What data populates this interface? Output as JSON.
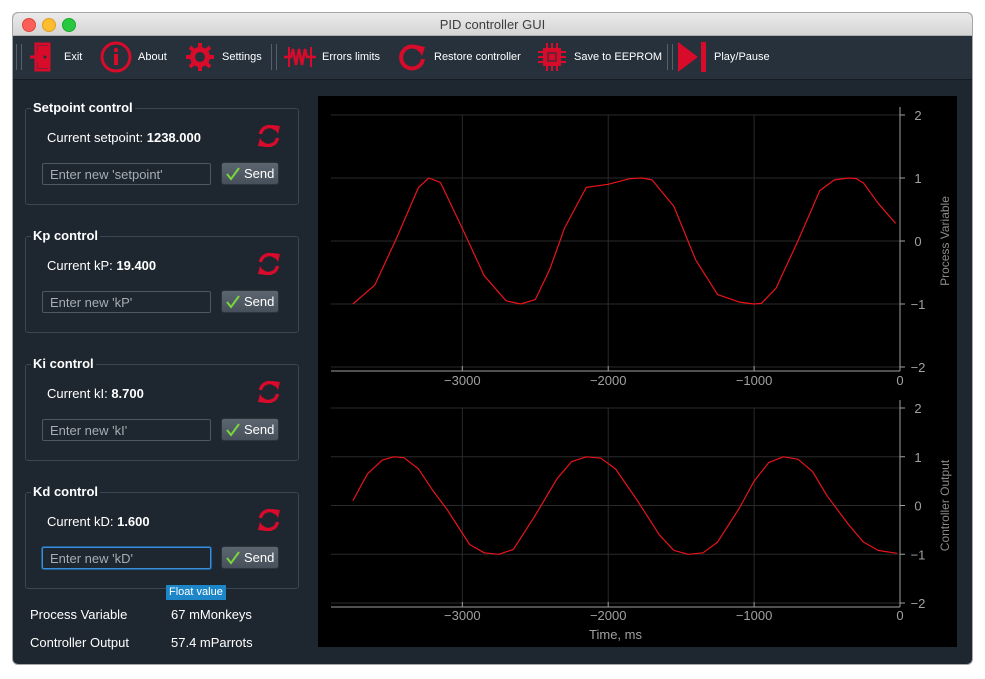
{
  "window": {
    "title": "PID controller GUI"
  },
  "toolbar": {
    "items": [
      {
        "label": "Exit",
        "icon": "exit-door-icon"
      },
      {
        "label": "About",
        "icon": "info-circle-icon"
      },
      {
        "label": "Settings",
        "icon": "gear-icon"
      },
      {
        "label": "Errors limits",
        "icon": "resistor-icon"
      },
      {
        "label": "Restore controller",
        "icon": "restore-arrow-icon"
      },
      {
        "label": "Save to EEPROM",
        "icon": "chip-icon"
      },
      {
        "label": "Play/Pause",
        "icon": "play-pause-icon"
      }
    ],
    "icon_color": "#d80b2b"
  },
  "controls": [
    {
      "title": "Setpoint control",
      "label": "Current setpoint:",
      "value": "1238.000",
      "placeholder": "Enter new 'setpoint'",
      "send": "Send"
    },
    {
      "title": "Kp control",
      "label": "Current kP:",
      "value": "19.400",
      "placeholder": "Enter new 'kP'",
      "send": "Send"
    },
    {
      "title": "Ki control",
      "label": "Current kI:",
      "value": "8.700",
      "placeholder": "Enter new 'kI'",
      "send": "Send"
    },
    {
      "title": "Kd control",
      "label": "Current kD:",
      "value": "1.600",
      "placeholder": "Enter new 'kD'",
      "send": "Send",
      "focused": true
    }
  ],
  "tooltip": "Float value",
  "status": {
    "process_variable": {
      "label": "Process Variable",
      "value": "67 mMonkeys"
    },
    "controller_output": {
      "label": "Controller Output",
      "value": "57.4 mParrots"
    }
  },
  "chart_data": [
    {
      "type": "line",
      "ylabel": "Process Variable",
      "xlabel": "",
      "xlim": [
        -3900,
        0
      ],
      "ylim": [
        -2,
        2
      ],
      "x_ticks": [
        "−3000",
        "−2000",
        "−1000",
        "0"
      ],
      "y_ticks": [
        "2",
        "1",
        "0",
        "−1",
        "−2"
      ],
      "grid": true,
      "line_color": "#e8141a",
      "series": [
        {
          "x": [
            -3750,
            -3600,
            -3450,
            -3300,
            -3230,
            -3150,
            -3000,
            -2850,
            -2700,
            -2600,
            -2500,
            -2400,
            -2300,
            -2150,
            -2000,
            -1850,
            -1770,
            -1700,
            -1550,
            -1400,
            -1250,
            -1100,
            -1000,
            -950,
            -850,
            -700,
            -550,
            -450,
            -350,
            -300,
            -250,
            -150,
            -30
          ],
          "y": [
            -1.0,
            -0.7,
            0.05,
            0.85,
            1.0,
            0.93,
            0.2,
            -0.55,
            -0.95,
            -1.0,
            -0.93,
            -0.45,
            0.2,
            0.85,
            0.9,
            0.99,
            1.0,
            0.97,
            0.55,
            -0.3,
            -0.85,
            -0.97,
            -1.0,
            -0.99,
            -0.75,
            0.0,
            0.8,
            0.97,
            1.0,
            0.99,
            0.92,
            0.6,
            0.28
          ]
        }
      ]
    },
    {
      "type": "line",
      "ylabel": "Controller Output",
      "xlabel": "Time, ms",
      "xlim": [
        -3900,
        0
      ],
      "ylim": [
        -2,
        2
      ],
      "x_ticks": [
        "−3000",
        "−2000",
        "−1000",
        "0"
      ],
      "y_ticks": [
        "2",
        "1",
        "0",
        "−1",
        "−2"
      ],
      "grid": true,
      "line_color": "#e8141a",
      "series": [
        {
          "x": [
            -3750,
            -3650,
            -3550,
            -3470,
            -3400,
            -3300,
            -3200,
            -3100,
            -2950,
            -2850,
            -2750,
            -2650,
            -2500,
            -2350,
            -2250,
            -2150,
            -2050,
            -1950,
            -1800,
            -1650,
            -1550,
            -1450,
            -1350,
            -1250,
            -1100,
            -1000,
            -900,
            -800,
            -700,
            -600,
            -500,
            -350,
            -250,
            -150,
            -20
          ],
          "y": [
            0.1,
            0.65,
            0.93,
            1.0,
            0.98,
            0.75,
            0.3,
            -0.1,
            -0.8,
            -0.97,
            -1.0,
            -0.9,
            -0.2,
            0.55,
            0.9,
            1.0,
            0.97,
            0.75,
            0.1,
            -0.6,
            -0.92,
            -1.0,
            -0.97,
            -0.75,
            -0.05,
            0.5,
            0.88,
            1.0,
            0.95,
            0.7,
            0.2,
            -0.4,
            -0.75,
            -0.92,
            -0.98
          ]
        }
      ]
    }
  ]
}
